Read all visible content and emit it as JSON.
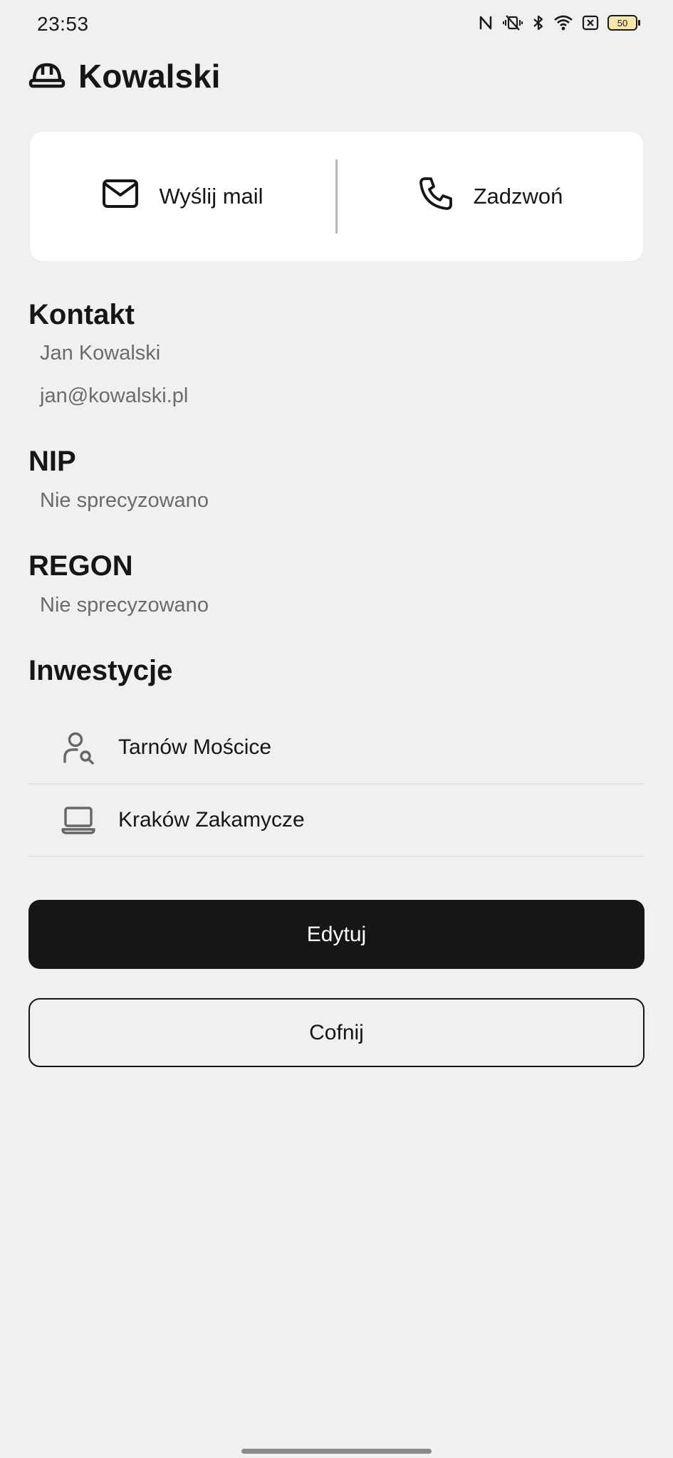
{
  "status_bar": {
    "time": "23:53",
    "icons": [
      "nfc-icon",
      "vibrate-mute-icon",
      "bluetooth-icon",
      "wifi-icon",
      "sim-x-icon",
      "battery-icon"
    ],
    "battery_level": "50"
  },
  "header": {
    "icon": "hard-hat-icon",
    "title": "Kowalski"
  },
  "actions": {
    "mail_label": "Wyślij mail",
    "mail_icon": "mail-icon",
    "call_label": "Zadzwoń",
    "call_icon": "phone-icon"
  },
  "contact": {
    "heading": "Kontakt",
    "name": "Jan Kowalski",
    "email": "jan@kowalski.pl"
  },
  "nip": {
    "heading": "NIP",
    "value": "Nie sprecyzowano"
  },
  "regon": {
    "heading": "REGON",
    "value": "Nie sprecyzowano"
  },
  "investments": {
    "heading": "Inwestycje",
    "items": [
      {
        "label": "Tarnów Mościce",
        "icon": "user-search-icon"
      },
      {
        "label": "Kraków Zakamycze",
        "icon": "laptop-icon"
      }
    ]
  },
  "buttons": {
    "edit_label": "Edytuj",
    "back_label": "Cofnij"
  },
  "colors": {
    "background": "#f0f0f0",
    "card": "#ffffff",
    "primary": "#161616",
    "muted_text": "#6b6b6b"
  }
}
